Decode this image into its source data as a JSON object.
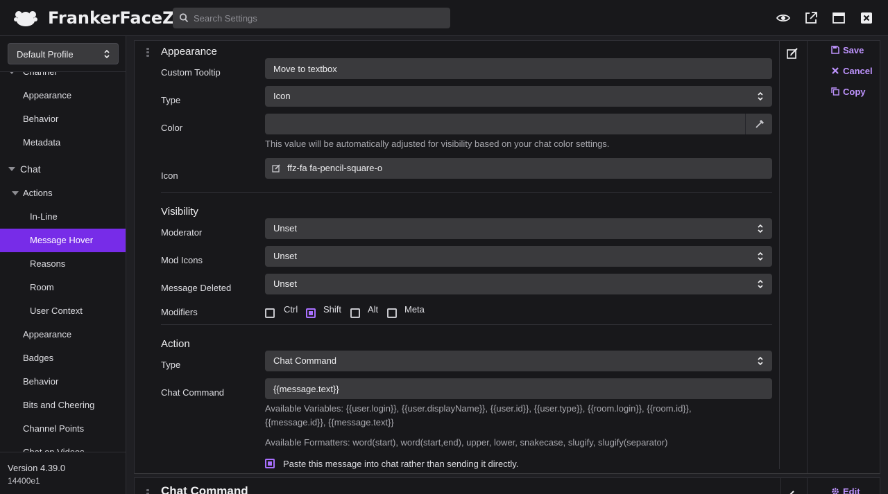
{
  "app": {
    "title": "FrankerFaceZ"
  },
  "search": {
    "placeholder": "Search Settings"
  },
  "header_icons": [
    "eye-icon",
    "external-link-icon",
    "window-icon",
    "close-icon"
  ],
  "sidebar": {
    "profile": "Default Profile",
    "items": [
      {
        "label": "Channel",
        "level": 1,
        "expanded": true
      },
      {
        "label": "Appearance",
        "level": 2
      },
      {
        "label": "Behavior",
        "level": 2
      },
      {
        "label": "Metadata",
        "level": 2
      },
      {
        "label": "Chat",
        "level": 0,
        "expanded": true
      },
      {
        "label": "Actions",
        "level": 1,
        "expanded": true
      },
      {
        "label": "In-Line",
        "level": 2
      },
      {
        "label": "Message Hover",
        "level": 2,
        "active": true
      },
      {
        "label": "Reasons",
        "level": 2
      },
      {
        "label": "Room",
        "level": 2
      },
      {
        "label": "User Context",
        "level": 2
      },
      {
        "label": "Appearance",
        "level": 1
      },
      {
        "label": "Badges",
        "level": 1
      },
      {
        "label": "Behavior",
        "level": 1
      },
      {
        "label": "Bits and Cheering",
        "level": 1
      },
      {
        "label": "Channel Points",
        "level": 1
      },
      {
        "label": "Chat on Videos",
        "level": 1
      }
    ],
    "version": "Version 4.39.0",
    "build": "14400e1"
  },
  "editor": {
    "appearance": {
      "heading": "Appearance",
      "tooltip_label": "Custom Tooltip",
      "tooltip_value": "Move to textbox",
      "type_label": "Type",
      "type_value": "Icon",
      "color_label": "Color",
      "color_value": "",
      "color_hint": "This value will be automatically adjusted for visibility based on your chat color settings.",
      "icon_label": "Icon",
      "icon_value": "ffz-fa fa-pencil-square-o"
    },
    "visibility": {
      "heading": "Visibility",
      "moderator_label": "Moderator",
      "moderator_value": "Unset",
      "modicons_label": "Mod Icons",
      "modicons_value": "Unset",
      "deleted_label": "Message Deleted",
      "deleted_value": "Unset",
      "modifiers_label": "Modifiers",
      "modifiers": [
        {
          "label": "Ctrl",
          "checked": false
        },
        {
          "label": "Shift",
          "checked": true
        },
        {
          "label": "Alt",
          "checked": false
        },
        {
          "label": "Meta",
          "checked": false
        }
      ]
    },
    "action": {
      "heading": "Action",
      "type_label": "Type",
      "type_value": "Chat Command",
      "command_label": "Chat Command",
      "command_value": "{{message.text}}",
      "variables_line1": "Available Variables: {{user.login}}, {{user.displayName}}, {{user.id}}, {{user.type}}, {{room.login}}, {{room.id}},",
      "variables_line2": "{{message.id}}, {{message.text}}",
      "formatters": "Available Formatters: word(start), word(start,end), upper, lower, snakecase, slugify, slugify(separator)",
      "paste_label": "Paste this message into chat rather than sending it directly.",
      "paste_checked": true
    },
    "buttons": {
      "save": "Save",
      "cancel": "Cancel",
      "copy": "Copy",
      "edit": "Edit"
    }
  },
  "next_item": {
    "title": "Chat Command"
  },
  "colors": {
    "accent": "#772ce8",
    "link": "#bf94ff",
    "background": "#18181b",
    "field": "#3a3a3d"
  }
}
